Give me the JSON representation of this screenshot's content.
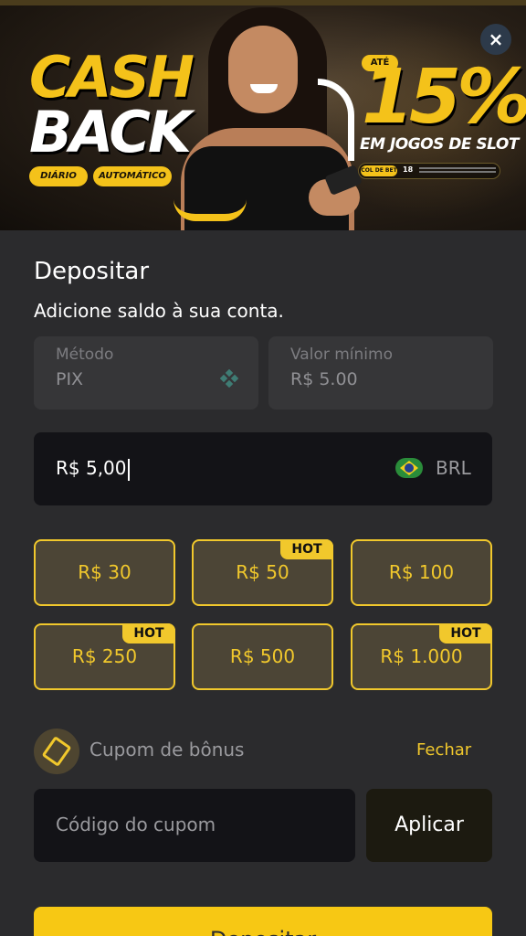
{
  "banner": {
    "cash": "CASH",
    "back": "BACK",
    "pill_1": "DIÁRIO",
    "pill_2": "AUTOMÁTICO",
    "ate": "ATÉ",
    "percent": "15%",
    "slot_text": "EM JOGOS DE SLOT",
    "fine_tag": "COL DE BET",
    "fine_age": "18",
    "close_icon": "×"
  },
  "deposit": {
    "title": "Depositar",
    "subtitle": "Adicione saldo à sua conta.",
    "method_label": "Método",
    "method_value": "PIX",
    "min_label": "Valor mínimo",
    "min_value": "R$ 5.00",
    "amount_value": "R$ 5,00",
    "currency": "BRL",
    "presets": [
      {
        "label": "R$ 30",
        "hot": ""
      },
      {
        "label": "R$ 50",
        "hot": "HOT"
      },
      {
        "label": "R$ 100",
        "hot": ""
      },
      {
        "label": "R$ 250",
        "hot": "HOT"
      },
      {
        "label": "R$ 500",
        "hot": ""
      },
      {
        "label": "R$ 1.000",
        "hot": "HOT"
      }
    ],
    "coupon_label": "Cupom de bônus",
    "coupon_toggle": "Fechar",
    "coupon_placeholder": "Código do cupom",
    "apply_label": "Aplicar",
    "submit_label": "Depositar"
  },
  "colors": {
    "accent": "#f1c82c",
    "background": "#2b2b2d",
    "field_dark": "#131317"
  }
}
